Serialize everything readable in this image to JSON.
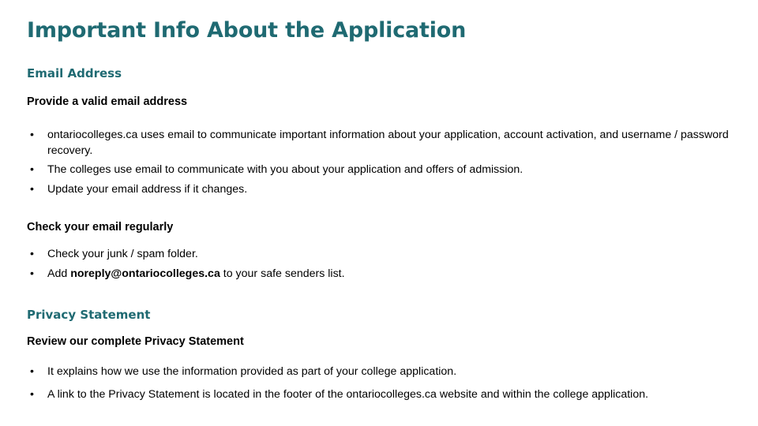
{
  "slide": {
    "title": "Important Info About the Application",
    "accent_color": "#1F6A72",
    "text_color": "#000000",
    "background_color": "#FFFFFF",
    "bullet_glyph": "•"
  },
  "sections": [
    {
      "heading": "Email Address",
      "sub_heading": "Provide a valid email address",
      "bullets": [
        "ontariocolleges.ca uses email to communicate important information about your application, account activation, and username / password recovery.",
        "The colleges use email to communicate with you about your application and offers of admission.",
        "Update your email address if it changes."
      ]
    },
    {
      "sub_heading": "Check your email regularly",
      "bullets": [
        "Check your junk / spam folder.",
        "Add noreply@ontariocolleges.ca to your safe senders list."
      ],
      "bullet_bold_fragment": "noreply@ontariocolleges.ca",
      "bullet_2_prefix": "Add ",
      "bullet_2_suffix": " to your safe senders list."
    },
    {
      "heading": "Privacy Statement",
      "sub_heading": "Review our complete Privacy Statement",
      "bullets": [
        "It explains how we use the information provided as part of your college application.",
        "A link to the Privacy Statement is located in the footer of the ontariocolleges.ca website and within the college application."
      ]
    }
  ]
}
